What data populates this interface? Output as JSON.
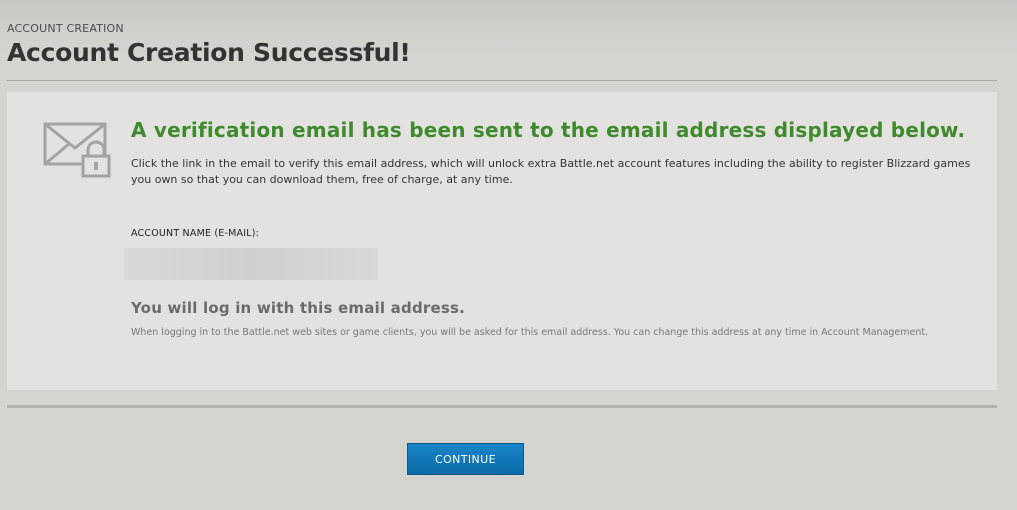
{
  "header": {
    "breadcrumb": "ACCOUNT CREATION",
    "title": "Account Creation Successful!"
  },
  "panel": {
    "icon": "envelope-lock-icon",
    "headline": "A verification email has been sent to the email address displayed below.",
    "description": "Click the link in the email to verify this email address, which will unlock extra Battle.net account features including the ability to register Blizzard games you own so that you can download them, free of charge, at any time.",
    "account_label": "ACCOUNT NAME (E-MAIL):",
    "account_value": "",
    "login_note": "You will log in with this email address.",
    "login_detail": "When logging in to the Battle.net web sites or game clients, you will be asked for this email address. You can change this address at any time in Account Management."
  },
  "actions": {
    "continue_label": "CONTINUE"
  },
  "colors": {
    "headline": "#3e8a2c",
    "button": "#0a6aa8",
    "background": "#d6d4cf",
    "panel": "#e3e2e0"
  }
}
